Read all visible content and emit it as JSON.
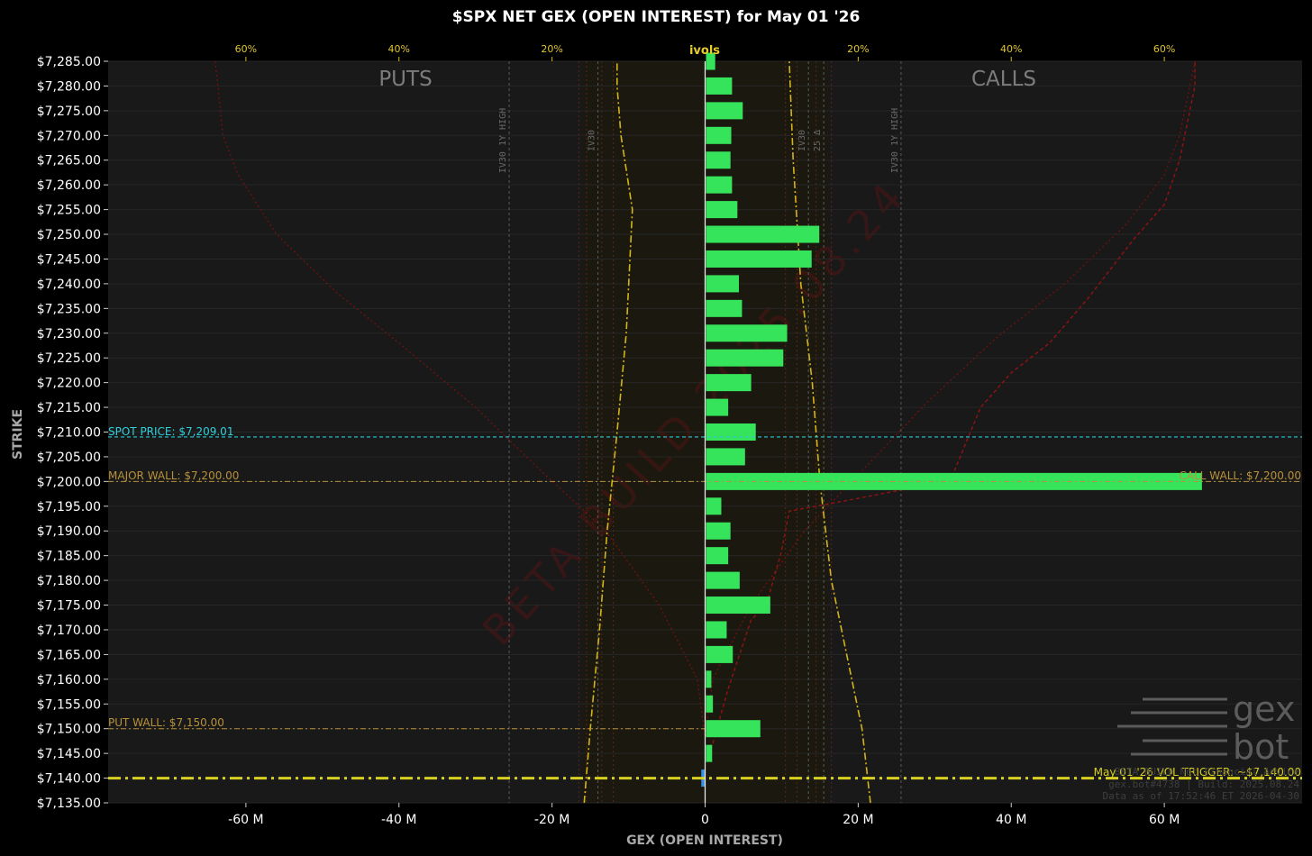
{
  "chart_data": {
    "type": "bar",
    "orientation": "horizontal",
    "title": "$SPX NET GEX (OPEN INTEREST) for May 01 '26",
    "xlabel": "GEX (OPEN INTEREST)",
    "ylabel": "STRIKE",
    "xlim": [
      -78,
      78
    ],
    "ylim": [
      7135,
      7285
    ],
    "x_unit": "M",
    "x_ticks": [
      -60,
      -40,
      -20,
      0,
      20,
      40,
      60
    ],
    "x_tick_labels": [
      "-60 M",
      "-40 M",
      "-20 M",
      "0",
      "20 M",
      "40 M",
      "60 M"
    ],
    "top_axis_label": "ivols",
    "top_ticks": [
      -60,
      -40,
      -20,
      20,
      40,
      60
    ],
    "top_tick_labels": [
      "60%",
      "40%",
      "20%",
      "20%",
      "40%",
      "60%"
    ],
    "side_labels": {
      "left": "PUTS",
      "right": "CALLS"
    },
    "strikes": [
      7285,
      7280,
      7275,
      7270,
      7265,
      7260,
      7255,
      7250,
      7245,
      7240,
      7235,
      7230,
      7225,
      7220,
      7215,
      7210,
      7205,
      7200,
      7195,
      7190,
      7185,
      7180,
      7175,
      7170,
      7165,
      7160,
      7155,
      7150,
      7145,
      7140,
      7135
    ],
    "strike_labels": [
      "$7,285.00",
      "$7,280.00",
      "$7,275.00",
      "$7,270.00",
      "$7,265.00",
      "$7,260.00",
      "$7,255.00",
      "$7,250.00",
      "$7,245.00",
      "$7,240.00",
      "$7,235.00",
      "$7,230.00",
      "$7,225.00",
      "$7,220.00",
      "$7,215.00",
      "$7,210.00",
      "$7,205.00",
      "$7,200.00",
      "$7,195.00",
      "$7,190.00",
      "$7,185.00",
      "$7,180.00",
      "$7,175.00",
      "$7,170.00",
      "$7,165.00",
      "$7,160.00",
      "$7,155.00",
      "$7,150.00",
      "$7,145.00",
      "$7,140.00",
      "$7,135.00"
    ],
    "series": [
      {
        "strikes": [
          7285,
          7280,
          7275,
          7270,
          7265,
          7260,
          7255,
          7250,
          7245,
          7240,
          7235,
          7230,
          7225,
          7220,
          7215,
          7210,
          7205,
          7200,
          7195,
          7190,
          7185,
          7180,
          7175,
          7170,
          7165,
          7160,
          7155,
          7150,
          7145,
          7140
        ],
        "values": [
          1.2,
          3.4,
          4.8,
          3.3,
          3.2,
          3.4,
          4.1,
          14.8,
          13.8,
          4.3,
          4.7,
          10.6,
          10.1,
          5.9,
          2.9,
          6.5,
          5.1,
          64.8,
          2.0,
          3.2,
          2.9,
          4.4,
          8.4,
          2.7,
          3.5,
          0.7,
          0.9,
          7.1,
          0.8,
          -0.5
        ]
      }
    ],
    "colors": {
      "positive": "#35e45a",
      "negative": "#3d8fe0",
      "spot": "#28c9d8",
      "wall": "#b8913a",
      "trigger": "#d8d020",
      "ivol": "#d4b417",
      "smile": "#7a1010",
      "profile": "#8a1313"
    },
    "annotations": {
      "spot_price": {
        "label": "SPOT PRICE: $7,209.01",
        "value": 7209.01
      },
      "major_wall": {
        "label": "MAJOR WALL: $7,200.00",
        "value": 7200
      },
      "call_wall": {
        "label": "CALL WALL: $7,200.00",
        "value": 7200
      },
      "put_wall": {
        "label": "PUT WALL: $7,150.00",
        "value": 7150
      },
      "vol_trigger": {
        "label": "May 01 '26 VOL TRIGGER: ~$7,140.00",
        "value": 7140
      }
    },
    "vertical_marks": [
      {
        "label": "IV30 1Y HIGH",
        "x": -25.6
      },
      {
        "label": "IV30",
        "x": -14
      },
      {
        "label": "25 Δ",
        "x": 15.5
      },
      {
        "label": "IV30",
        "x": 13.5
      },
      {
        "label": "IV30 1Y HIGH",
        "x": 25.6
      }
    ],
    "watermark": "BETA BUILD 2025.08.24",
    "footer": [
      "BETA BUILD Not Financial Advice",
      "gex.bot#4738 | Build: 2025.08.24",
      "Data as of 17:52:46 ET 2026-04-30"
    ],
    "logo": [
      "gex",
      "bot"
    ]
  }
}
